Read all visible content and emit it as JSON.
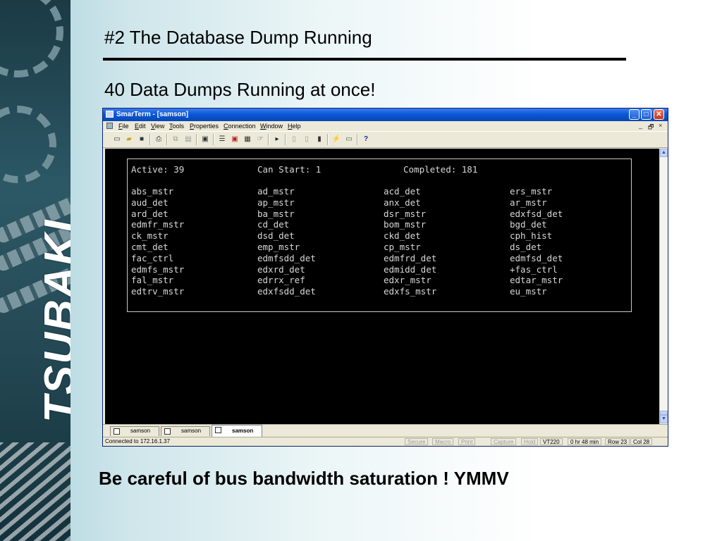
{
  "slide": {
    "title": "#2 The Database Dump Running",
    "subtitle": "40 Data Dumps Running at once!",
    "footer": "Be careful of bus bandwidth saturation !  YMMV",
    "logo_text": "TSUBAKI",
    "colors": {
      "background_left": "#a9d2db",
      "banner": "#2c5866",
      "text": "#000000"
    }
  },
  "window": {
    "title": "SmarTerm - [samson]",
    "caption_buttons": {
      "minimize": "_",
      "maximize": "□",
      "close": "✕"
    },
    "menu": [
      "File",
      "Edit",
      "View",
      "Tools",
      "Properties",
      "Connection",
      "Window",
      "Help"
    ],
    "mdi_buttons": [
      "_",
      "🗗",
      "×"
    ],
    "toolbar_icons": [
      "new-icon",
      "open-icon",
      "save-icon",
      "print-icon",
      "copy-icon",
      "paste-icon",
      "properties-icon",
      "list-icon",
      "macro-icon",
      "capture-icon",
      "hotspot-icon",
      "play-icon",
      "page-icon",
      "page2-icon",
      "bookmark-icon",
      "connect-icon",
      "monitor-icon",
      "help-icon"
    ],
    "colors": {
      "titlebar": "#0a58d6",
      "terminal_bg": "#000000",
      "terminal_text": "#d8d8d8",
      "chrome": "#ece9d8"
    }
  },
  "terminal": {
    "header": {
      "active": "Active: 39",
      "can_start": "Can Start: 1",
      "completed": "Completed: 181"
    },
    "columns": [
      [
        "abs_mstr",
        "aud_det",
        "ard_det",
        "edmfr_mstr",
        "ck_mstr",
        "cmt_det",
        "fac_ctrl",
        "edmfs_mstr",
        "fal_mstr",
        "edtrv_mstr"
      ],
      [
        "ad_mstr",
        "ap_mstr",
        "ba_mstr",
        "cd_det",
        "dsd_det",
        "emp_mstr",
        "edmfsdd_det",
        "edxrd_det",
        "edrrx_ref",
        "edxfsdd_det"
      ],
      [
        "acd_det",
        "anx_det",
        "dsr_mstr",
        "bom_mstr",
        "ckd_det",
        "cp_mstr",
        "edmfrd_det",
        "edmidd_det",
        "edxr_mstr",
        "edxfs_mstr"
      ],
      [
        "ers_mstr",
        "ar_mstr",
        "edxfsd_det",
        "bgd_det",
        "cph_hist",
        "ds_det",
        "edmfsd_det",
        "+fas_ctrl",
        "edtar_mstr",
        "eu_mstr"
      ]
    ]
  },
  "tabs": [
    {
      "label": "samson",
      "active": false
    },
    {
      "label": "samson",
      "active": false
    },
    {
      "label": "samson",
      "active": true
    }
  ],
  "status": {
    "connection": "Connected to 172.16.1.37",
    "indicators": [
      "Secure",
      "Macro",
      "Print",
      "Capture",
      "Hold"
    ],
    "emulation": "VT220",
    "timer": "0 hr 48 min",
    "row": "Row 23",
    "col": "Col 28"
  }
}
